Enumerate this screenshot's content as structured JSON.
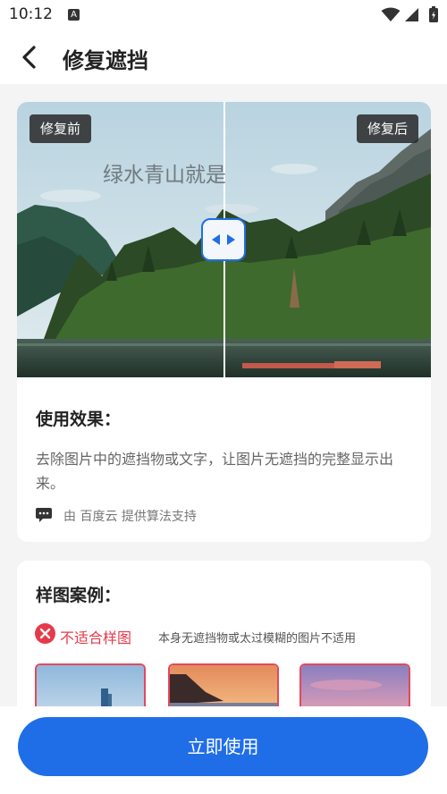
{
  "status_bar": {
    "time": "10:12",
    "notification_letter": "A"
  },
  "app_bar": {
    "title": "修复遮挡"
  },
  "comparison": {
    "before_label": "修复前",
    "after_label": "修复后",
    "overlay_text": "绿水青山就是"
  },
  "effect": {
    "heading": "使用效果：",
    "description": "去除图片中的遮挡物或文字，让图片无遮挡的完整显示出来。",
    "credit": "由 百度云 提供算法支持"
  },
  "samples": {
    "heading": "样图案例：",
    "unsuitable_label": "不适合样图",
    "unsuitable_desc": "本身无遮挡物或太过模糊的图片不适用"
  },
  "action": {
    "use_now_label": "立即使用"
  },
  "colors": {
    "primary": "#1f6ee8",
    "warning": "#e53a4b"
  }
}
